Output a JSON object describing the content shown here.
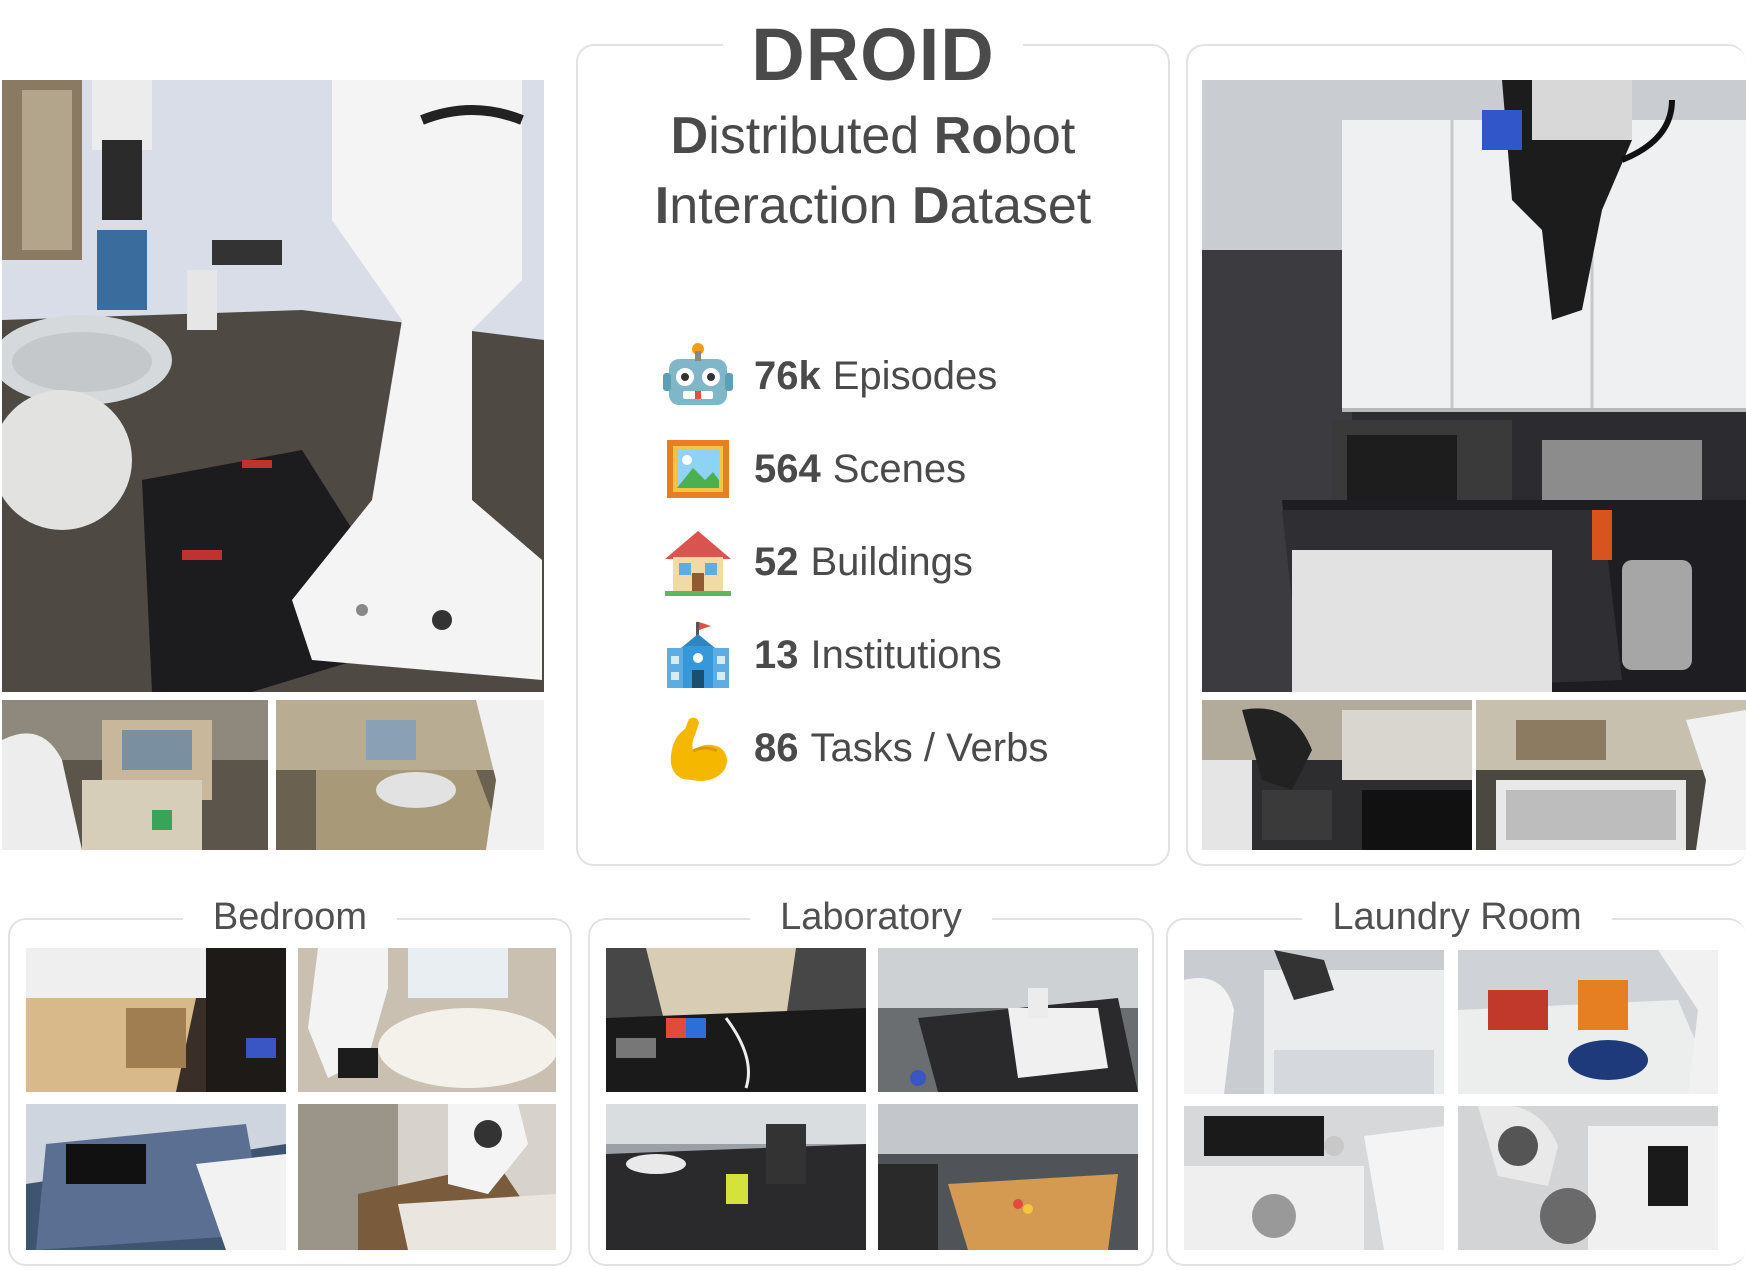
{
  "title": "DROID",
  "subtitle": {
    "line1": [
      {
        "text": "D",
        "bold": true
      },
      {
        "text": "istributed ",
        "bold": false
      },
      {
        "text": "Ro",
        "bold": true
      },
      {
        "text": "bot",
        "bold": false
      }
    ],
    "line2": [
      {
        "text": "I",
        "bold": true
      },
      {
        "text": "nteraction ",
        "bold": false
      },
      {
        "text": "D",
        "bold": true
      },
      {
        "text": "ataset",
        "bold": false
      }
    ]
  },
  "stats": [
    {
      "icon": "robot-face-icon",
      "value": "76k",
      "label": "Episodes"
    },
    {
      "icon": "framed-picture-icon",
      "value": "564",
      "label": "Scenes"
    },
    {
      "icon": "house-icon",
      "value": "52",
      "label": "Buildings"
    },
    {
      "icon": "school-building-icon",
      "value": "13",
      "label": "Institutions"
    },
    {
      "icon": "flexed-biceps-icon",
      "value": "86",
      "label": "Tasks / Verbs"
    }
  ],
  "sections": {
    "bedroom": {
      "title": "Bedroom"
    },
    "laboratory": {
      "title": "Laboratory"
    },
    "laundry": {
      "title": "Laundry Room"
    }
  },
  "colors": {
    "text": "#4a4a4a",
    "border": "#e2e2e2",
    "robot_white": "#f2f2f2"
  }
}
